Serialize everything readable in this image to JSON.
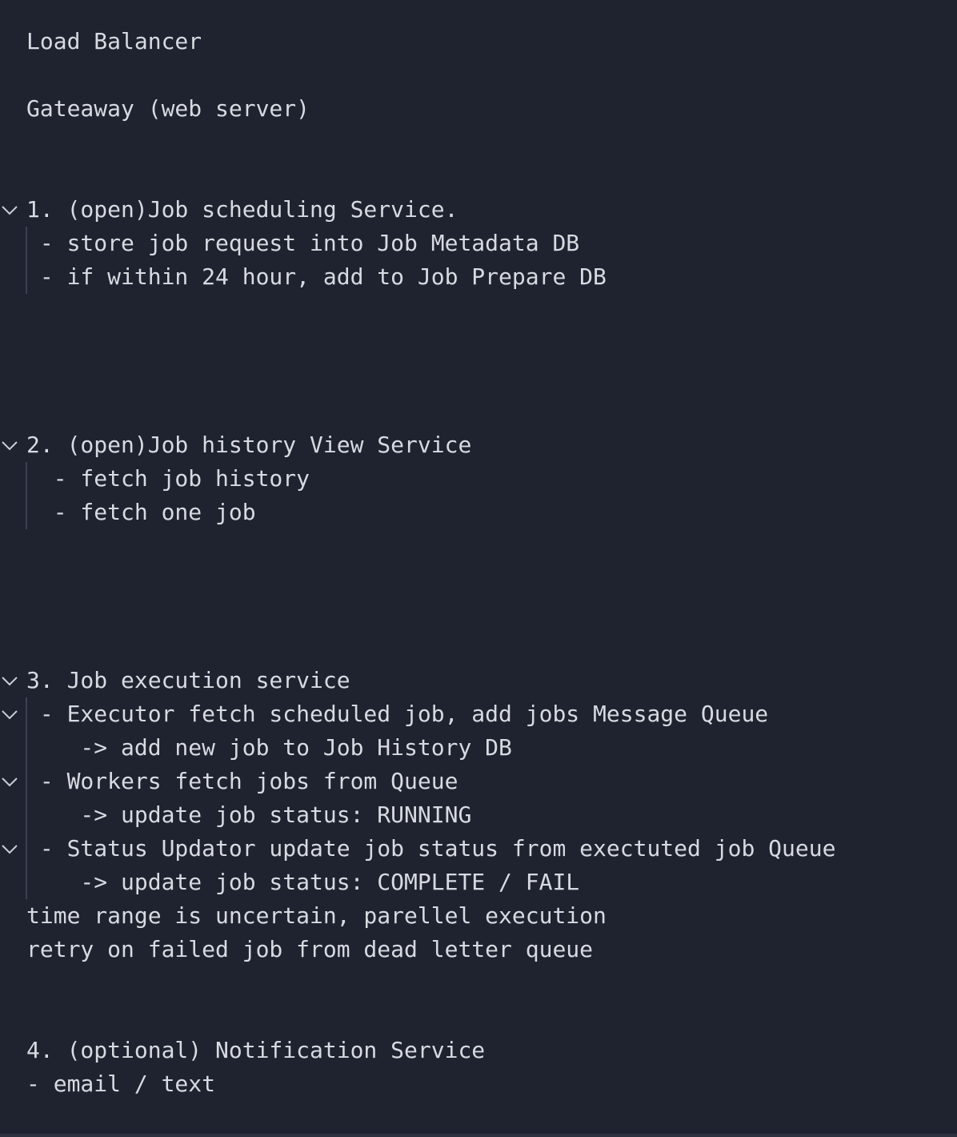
{
  "editor": {
    "lines": {
      "l1": "Load Balancer",
      "l2": "Gateaway (web server)",
      "l3": "1. (open)Job scheduling Service.",
      "l4": " - store job request into Job Metadata DB",
      "l5": " - if within 24 hour, add to Job Prepare DB",
      "l6": "2. (open)Job history View Service",
      "l7": "  - fetch job history",
      "l8": "  - fetch one job",
      "l9": "3. Job execution service",
      "l10": " - Executor fetch scheduled job, add jobs Message Queue",
      "l11": "    -> add new job to Job History DB",
      "l12": " - Workers fetch jobs from Queue",
      "l13": "    -> update job status: RUNNING",
      "l14": " - Status Updator update job status from exectuted job Queue",
      "l15": "    -> update job status: COMPLETE / FAIL",
      "l16": "time range is uncertain, parellel execution",
      "l17": "retry on failed job from dead letter queue",
      "l18": "4. (optional) Notification Service",
      "l19": "- email / text"
    },
    "fold_icon": "chevron-down-icon",
    "colors": {
      "background": "#1f2330",
      "text": "#d7dae0",
      "indent_guide": "#3b4150"
    }
  }
}
